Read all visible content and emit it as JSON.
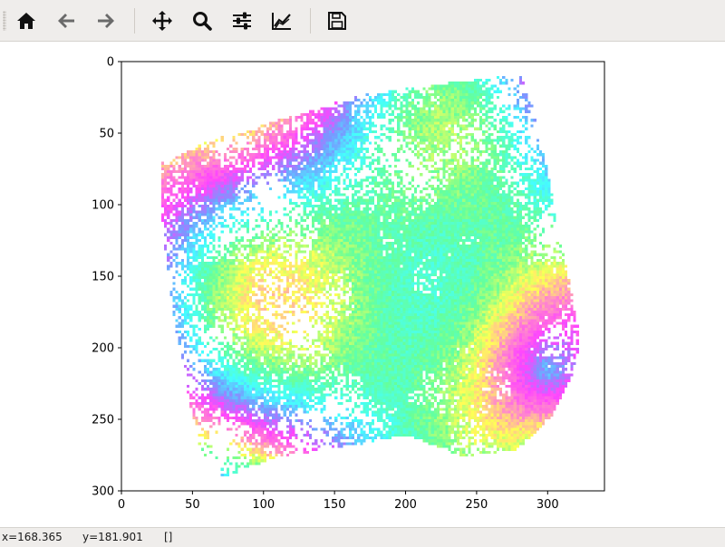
{
  "toolbar": {
    "buttons": [
      {
        "name": "home-button",
        "icon": "home-icon"
      },
      {
        "name": "back-button",
        "icon": "arrow-left-icon"
      },
      {
        "name": "forward-button",
        "icon": "arrow-right-icon"
      },
      {
        "name": "pan-button",
        "icon": "move-icon"
      },
      {
        "name": "zoom-button",
        "icon": "magnifier-icon"
      },
      {
        "name": "configure-subplots-button",
        "icon": "sliders-icon"
      },
      {
        "name": "edit-axes-button",
        "icon": "line-chart-icon"
      },
      {
        "name": "save-button",
        "icon": "floppy-disk-icon"
      }
    ]
  },
  "status": {
    "x": "x=168.365",
    "y": "y=181.901",
    "value": "[]"
  },
  "chart_data": {
    "type": "heatmap",
    "title": "",
    "xlabel": "",
    "ylabel": "",
    "xlim": [
      0,
      340
    ],
    "ylim": [
      300,
      0
    ],
    "x_ticks": [
      "0",
      "50",
      "100",
      "150",
      "200",
      "250",
      "300"
    ],
    "y_ticks": [
      "0",
      "50",
      "100",
      "150",
      "200",
      "250",
      "300"
    ],
    "y_inverted": true,
    "colormap": "cyclic",
    "colormap_colors": [
      "#ff44ff",
      "#ff88cc",
      "#ffff55",
      "#66ff99",
      "#44ffff",
      "#7799ff"
    ],
    "grid": false
  }
}
